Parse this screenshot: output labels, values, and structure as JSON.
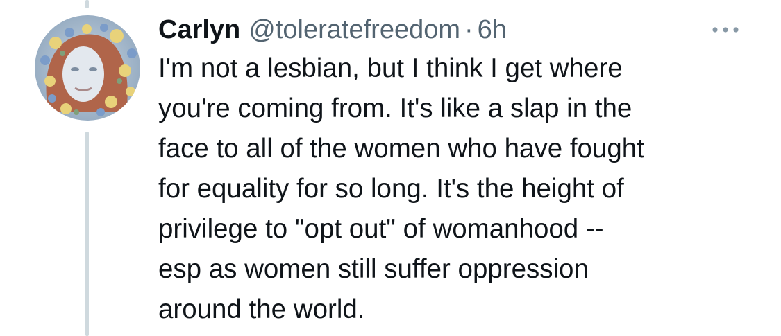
{
  "tweet": {
    "display_name": "Carlyn",
    "handle": "@toleratefreedom",
    "separator": "·",
    "timestamp": "6h",
    "more_icon": "ellipsis-icon",
    "avatar_icon": "profile-photo",
    "text_lines": [
      "I'm not a lesbian, but I think I get where",
      "you're coming from. It's like a slap in the",
      "face to all of the women who have fought",
      "for equality for so long. It's the height of",
      "privilege to \"opt out\" of womanhood --",
      "esp as women still suffer oppression",
      "around the world."
    ]
  },
  "colors": {
    "text": "#0f1419",
    "secondary": "#536471",
    "thread_line": "#cfd9de",
    "background": "#ffffff"
  }
}
